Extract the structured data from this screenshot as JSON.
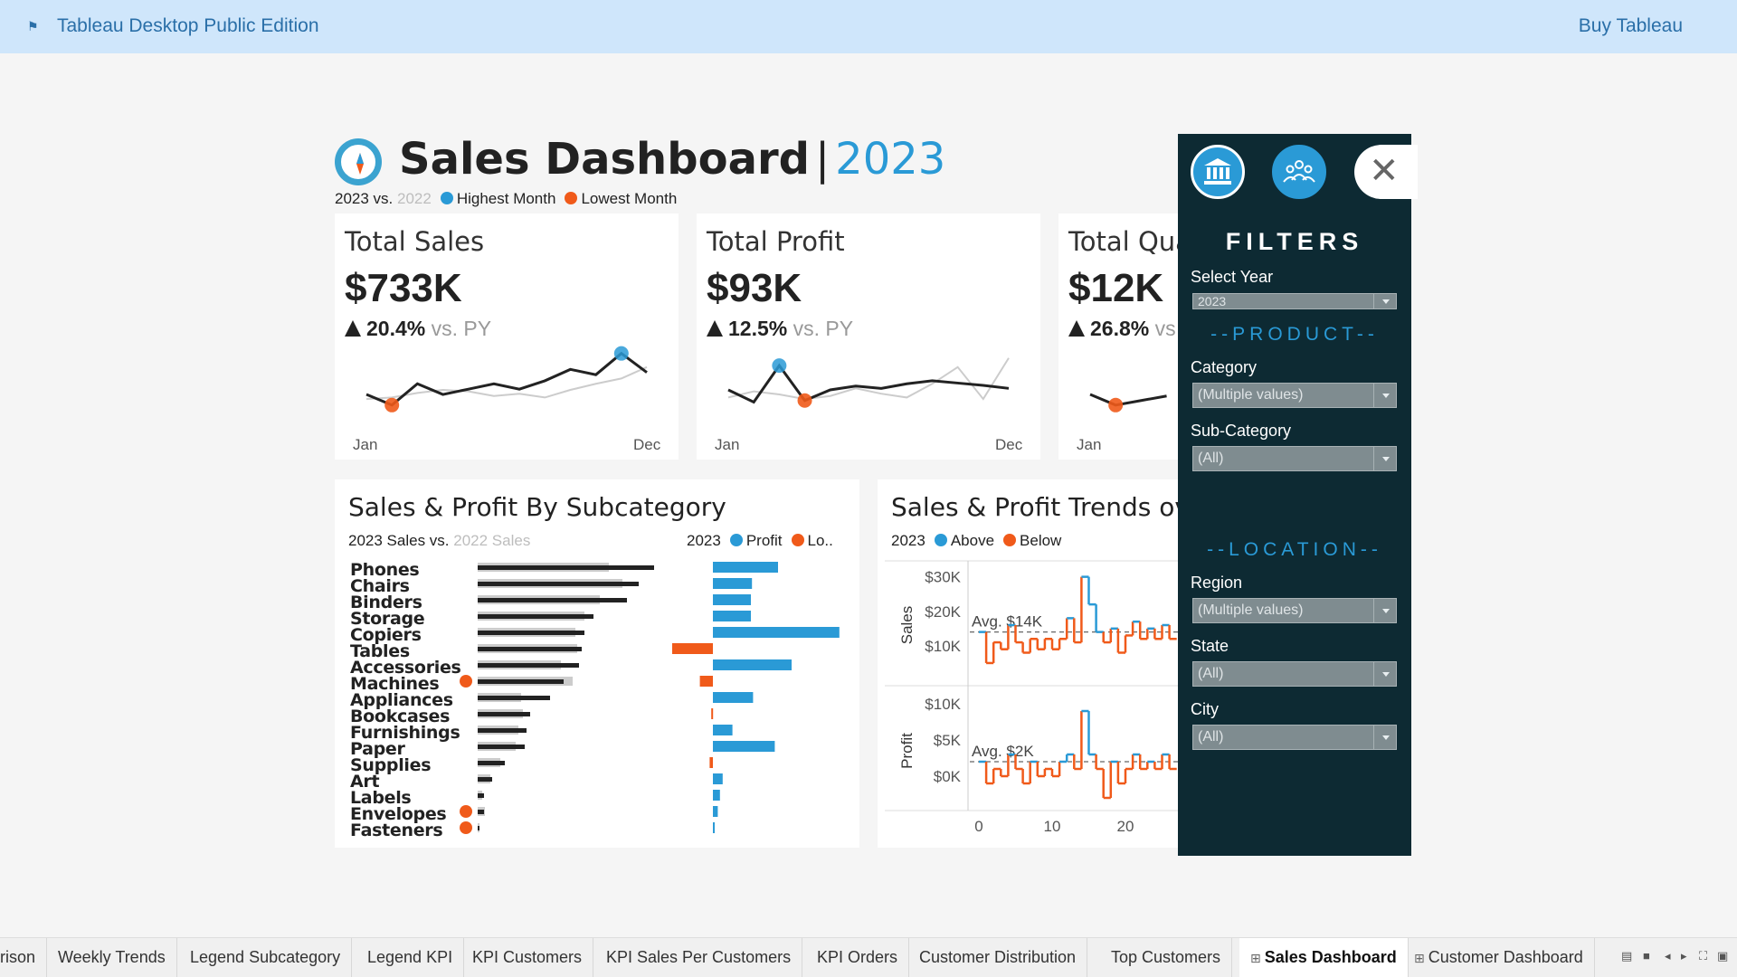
{
  "topbar": {
    "app_title": "Tableau Desktop Public Edition",
    "buy_label": "Buy Tableau"
  },
  "header": {
    "title": "Sales Dashboard",
    "separator": "|",
    "year": "2023",
    "compare_current": "2023 vs.",
    "compare_prev": "2022",
    "legend_high": "Highest Month",
    "legend_low": "Lowest Month"
  },
  "kpis": [
    {
      "label": "Total Sales",
      "value": "$733K",
      "delta": "20.4%",
      "vs": "vs. PY",
      "start": "Jan",
      "end": "Dec"
    },
    {
      "label": "Total Profit",
      "value": "$93K",
      "delta": "12.5%",
      "vs": "vs. PY",
      "start": "Jan",
      "end": "Dec"
    },
    {
      "label": "Total Qua",
      "value": "$12K",
      "delta": "26.8%",
      "vs": "vs",
      "start": "Jan",
      "end": "Dec"
    }
  ],
  "subcategory": {
    "title": "Sales & Profit By Subcategory",
    "sales_caption_current": "2023 Sales vs.",
    "sales_caption_prev": "2022 Sales",
    "profit_caption_year": "2023",
    "profit_caption_profit": "Profit",
    "profit_caption_loss": "Lo.."
  },
  "trends": {
    "title": "Sales & Profit Trends ove",
    "legend_year": "2023",
    "legend_above": "Above",
    "legend_below": "Below",
    "sales_axis_label": "Sales",
    "profit_axis_label": "Profit",
    "sales_ticks": [
      "$30K",
      "$20K",
      "$10K"
    ],
    "profit_ticks": [
      "$10K",
      "$5K",
      "$0K"
    ],
    "x_ticks": [
      "0",
      "10",
      "20"
    ],
    "avg_sales": "Avg. $14K",
    "avg_profit": "Avg. $2K"
  },
  "filters": {
    "title": "FILTERS",
    "select_year_label": "Select Year",
    "select_year_value": "2023",
    "product_section": "--PRODUCT--",
    "category_label": "Category",
    "category_value": "(Multiple values)",
    "subcategory_label": "Sub-Category",
    "subcategory_value": "(All)",
    "location_section": "--LOCATION--",
    "region_label": "Region",
    "region_value": "(Multiple values)",
    "state_label": "State",
    "state_value": "(All)",
    "city_label": "City",
    "city_value": "(All)"
  },
  "tabs": [
    "rison",
    "Weekly Trends",
    "Legend Subcategory",
    "Legend KPI",
    "KPI Customers",
    "KPI Sales Per Customers",
    "KPI Orders",
    "Customer Distribution",
    "Top Customers",
    "Sales Dashboard",
    "Customer Dashboard"
  ],
  "active_tab": "Sales Dashboard",
  "colors": {
    "accent_blue": "#2a9ad6",
    "accent_orange": "#f05a1a",
    "panel": "#0d2a33",
    "prior_year": "#cccccc"
  },
  "icons": [
    "megaphone-icon",
    "compass-icon",
    "bank-icon",
    "team-icon",
    "close-icon",
    "dashboard-tab-icon"
  ],
  "chart_data": [
    {
      "type": "line",
      "x": [
        "Jan",
        "Feb",
        "Mar",
        "Apr",
        "May",
        "Jun",
        "Jul",
        "Aug",
        "Sep",
        "Oct",
        "Nov",
        "Dec"
      ],
      "series": [
        {
          "values": [
            44,
            30,
            58,
            44,
            51,
            58,
            51,
            62,
            77,
            70,
            98,
            73
          ]
        },
        {
          "values": [
            38,
            40,
            46,
            50,
            48,
            42,
            45,
            40,
            50,
            58,
            65,
            80
          ]
        }
      ],
      "highlight_high": "Nov",
      "highlight_low": "Feb"
    },
    {
      "type": "line",
      "x": [
        "Jan",
        "Feb",
        "Mar",
        "Apr",
        "May",
        "Jun",
        "Jul",
        "Aug",
        "Sep",
        "Oct",
        "Nov",
        "Dec"
      ],
      "series": [
        {
          "values": [
            50,
            34,
            82,
            36,
            50,
            55,
            52,
            58,
            62,
            59,
            56,
            52
          ]
        },
        {
          "values": [
            40,
            48,
            44,
            38,
            42,
            52,
            45,
            40,
            58,
            80,
            38,
            92
          ]
        }
      ],
      "highlight_high": "Mar",
      "highlight_low": "Apr"
    },
    {
      "type": "line",
      "x": [
        "Jan",
        "Feb",
        "Mar",
        "Apr"
      ],
      "series": [
        {
          "values": [
            44,
            30,
            36,
            42
          ]
        }
      ],
      "highlight_low": "Feb"
    },
    {
      "type": "bar",
      "title": "Sales & Profit By Subcategory",
      "categories": [
        "Phones",
        "Chairs",
        "Binders",
        "Storage",
        "Copiers",
        "Tables",
        "Accessories",
        "Machines",
        "Appliances",
        "Bookcases",
        "Furnishings",
        "Paper",
        "Supplies",
        "Art",
        "Labels",
        "Envelopes",
        "Fasteners"
      ],
      "series": [
        {
          "name": "2023 Sales",
          "values": [
            195,
            178,
            165,
            128,
            118,
            115,
            112,
            95,
            80,
            58,
            54,
            52,
            30,
            16,
            7,
            7,
            2
          ]
        },
        {
          "name": "2022 Sales",
          "values": [
            145,
            160,
            135,
            118,
            108,
            110,
            92,
            105,
            48,
            50,
            45,
            42,
            25,
            14,
            5,
            8,
            2
          ]
        },
        {
          "name": "Profit",
          "values": [
            12.0,
            7.2,
            7.0,
            7.0,
            23.3,
            -7.5,
            14.5,
            -2.4,
            7.4,
            -0.3,
            3.6,
            11.4,
            -0.6,
            1.8,
            1.3,
            0.9,
            0.3
          ]
        }
      ],
      "loss_markers_on": [
        "Machines",
        "Envelopes",
        "Fasteners"
      ]
    },
    {
      "type": "line",
      "title": "Sales & Profit Trends ove",
      "ylabel": "Sales",
      "x": [
        0,
        1,
        2,
        3,
        4,
        5,
        6,
        7,
        8,
        9,
        10,
        11,
        12,
        13,
        14,
        15,
        16,
        17,
        18,
        19,
        20,
        21,
        22,
        23,
        24,
        25,
        26
      ],
      "series": [
        {
          "name": "Sales",
          "values": [
            14,
            5,
            11,
            9,
            16,
            11,
            8,
            12,
            9,
            12,
            9,
            12,
            18,
            11,
            30,
            22,
            14,
            11,
            15,
            8,
            13,
            17,
            12,
            15,
            12,
            16,
            12
          ]
        }
      ],
      "average": 14,
      "ylim": [
        0,
        32
      ]
    },
    {
      "type": "line",
      "ylabel": "Profit",
      "x": [
        0,
        1,
        2,
        3,
        4,
        5,
        6,
        7,
        8,
        9,
        10,
        11,
        12,
        13,
        14,
        15,
        16,
        17,
        18,
        19,
        20,
        21,
        22,
        23,
        24,
        25,
        26
      ],
      "series": [
        {
          "name": "Profit",
          "values": [
            2,
            -1,
            1,
            0,
            3,
            1,
            -1,
            2,
            0,
            1,
            0,
            2,
            3,
            1,
            9,
            3,
            1,
            -3,
            2,
            -1,
            1,
            3,
            1,
            2,
            1,
            3,
            1
          ]
        }
      ],
      "average": 2,
      "ylim": [
        -4,
        11
      ]
    }
  ]
}
